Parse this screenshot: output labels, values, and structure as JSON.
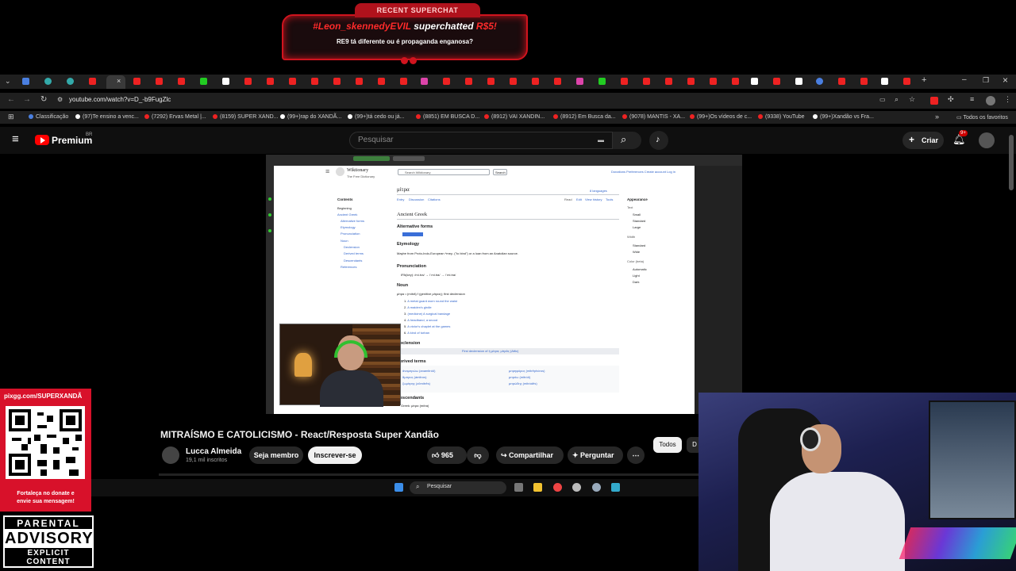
{
  "superchat": {
    "banner": "RECENT SUPERCHAT",
    "user": "#Leon_skennedyEVIL",
    "verb": " superchatted ",
    "amount": "R$5!",
    "message": "RE9 tá diferente ou é propaganda enganosa?"
  },
  "browser": {
    "url": "youtube.com/watch?v=D_-b9FugZlc",
    "bookmarks": [
      {
        "label": "Classificação",
        "color": "#4a7fe0"
      },
      {
        "label": "(97)Te ensino a venc...",
        "color": "#ffffff"
      },
      {
        "label": "(7292) Ervas Metal |...",
        "color": "#e22222"
      },
      {
        "label": "(8159) SUPER XAND...",
        "color": "#e22222"
      },
      {
        "label": "(99+)rap do XANDÃ...",
        "color": "#ffffff"
      },
      {
        "label": "(99+)tá cedo ou já...",
        "color": "#ffffff"
      },
      {
        "label": "(8851) EM BUSCA D...",
        "color": "#e22222"
      },
      {
        "label": "(8912) VAI XANDIN...",
        "color": "#e22222"
      },
      {
        "label": "(8912) Em Busca da...",
        "color": "#e22222"
      },
      {
        "label": "(9078) MANTIS - XA...",
        "color": "#e22222"
      },
      {
        "label": "(99+)Os vídeos de c...",
        "color": "#e22222"
      },
      {
        "label": "(9338) YouTube",
        "color": "#e22222"
      },
      {
        "label": "(99+)Xandão vs Fra...",
        "color": "#ffffff"
      }
    ],
    "all_favorites": "Todos os favoritos"
  },
  "youtube": {
    "brand": "Premium",
    "region": "BR",
    "search_placeholder": "Pesquisar",
    "create_label": "Criar",
    "notif_badge": "9+"
  },
  "wiki": {
    "site_name": "Wiktionary",
    "site_tagline": "The Free Dictionary",
    "search_placeholder": "Search Wiktionary",
    "search_button": "Search",
    "user_links": "Donations  Preferences  Create account  Log in",
    "title": "μίτρα",
    "languages": "8 languages",
    "tab_entry": "Entry",
    "tab_discussion": "Discussion",
    "tab_citations": "Citations",
    "tab_read": "Read",
    "tab_edit": "Edit",
    "tab_history": "View history",
    "tab_tools": "Tools",
    "contents": "Contents",
    "toc": [
      "Beginning",
      "Ancient Greek",
      "Alternative forms",
      "Etymology",
      "Pronunciation",
      "Noun",
      "Declension",
      "Derived terms",
      "Descendants",
      "References"
    ],
    "lang_heading": "Ancient Greek",
    "alt_forms": "Alternative forms",
    "etymology": "Etymology",
    "etym_text": "Maybe from Proto-Indo-European *mey- (\"to bind\") or a loan from an Anatolian source.",
    "pronunciation": "Pronunciation",
    "ipa": "IPA(key): /mí.tra/ → /ˈmi.tra/ → /ˈmi.tra/",
    "noun": "Noun",
    "noun_line": "μίτρα • (mítrā) f (genitive μίτρας); first declension",
    "senses": [
      "A metal guard worn round the waist",
      "A maiden's girdle",
      "(medicine) A surgical bandage",
      "A headband, a snood",
      "A victor's chaplet at the games",
      "A kind of turban"
    ],
    "declension": "Declension",
    "decl_table": "First declension of ἡ μίτρα; μίτρᾱς (Attic)",
    "derived": "Derived terms",
    "derived_left": [
      "ἀναμιτρώω (anamitróō)",
      "ἄμιτρος (ámitros)",
      "ζωμίτρης (zōmítrēs)"
    ],
    "derived_right": [
      "μιτρηφόρος (mitrēphóros)",
      "μιτρόω (mitróō)",
      "μιτρώδης (mitródēs)"
    ],
    "descendants": "Descendants",
    "descendant_item": "Greek: μίτρα (mítra)",
    "appearance": "Appearance",
    "text_label": "Text",
    "text_opts": [
      "Small",
      "Standard",
      "Large"
    ],
    "width_label": "Width",
    "width_opts": [
      "Standard",
      "Wide"
    ],
    "color_label": "Color (beta)",
    "color_opts": [
      "Automatic",
      "Light",
      "Dark"
    ]
  },
  "video": {
    "title": "MITRAÍSMO E CATOLICISMO - React/Resposta Super Xandão",
    "channel": "Lucca Almeida",
    "subscribers": "19,1 mil inscritos",
    "join_label": "Seja membro",
    "subscribe_label": "Inscrever-se",
    "likes": "965",
    "share_label": "Compartilhar",
    "ask_label": "Perguntar",
    "chip_all": "Todos",
    "chip_next": "D"
  },
  "taskbar": {
    "search_placeholder": "Pesquisar"
  },
  "qr": {
    "url": "pixgg.com/SUPERXANDÃ",
    "caption_1": "Fortaleça no donate e",
    "caption_2": "envie sua mensagem!"
  },
  "advisory": {
    "top": "PARENTAL",
    "mid": "ADVISORY",
    "bottom": "EXPLICIT CONTENT"
  }
}
